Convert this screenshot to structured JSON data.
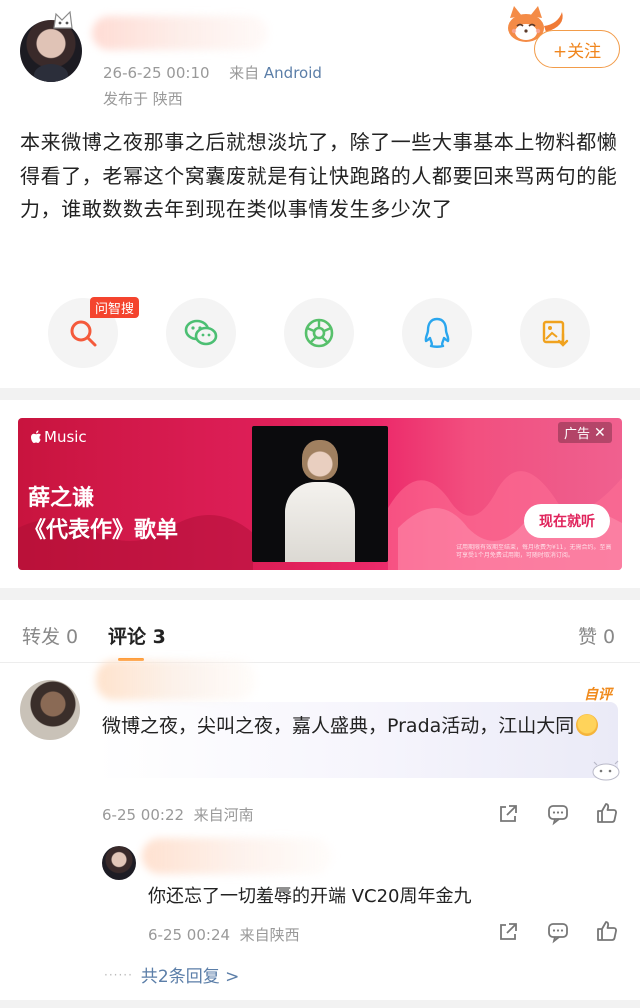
{
  "post": {
    "date": "26-6-25 00:10",
    "source_prefix": "来自",
    "source": "Android",
    "location": "发布于 陕西",
    "follow_label": "+关注",
    "text": "本来微博之夜那事之后就想淡坑了，除了一些大事基本上物料都懒得看了，老幂这个窝囊废就是有让快跑路的人都要回来骂两句的能力，谁敢数数去年到现在类似事情发生多少次了",
    "search_badge": "问智搜"
  },
  "banner": {
    "brand": "Music",
    "title_line1": "薛之谦",
    "title_line2": "《代表作》歌单",
    "ad_label": "广告",
    "cta": "现在就听",
    "fine_print": "试用期限有效期至结束，每月收费为¥11，无需合约。至高可享受1个月免费试用期，可随时取消订阅。"
  },
  "tabs": {
    "repost_label": "转发 0",
    "comment_label": "评论 3",
    "like_label": "赞 0"
  },
  "comment": {
    "self_badge": "自评",
    "text": "微博之夜，尖叫之夜，嘉人盛典，Prada活动，江山大同",
    "meta": "6-25 00:22  来自河南"
  },
  "reply": {
    "text": "你还忘了一切羞辱的开端 VC20周年金九",
    "meta": "6-25 00:24  来自陕西",
    "more_prefix": "······",
    "more": "共2条回复 >"
  },
  "colors": {
    "accent": "#ff8200",
    "link": "#5b7ea8",
    "wechat": "#4cbf73",
    "moments": "#57c06b",
    "qq": "#2aa6ee",
    "save": "#f0a21e",
    "search": "#f45a3b"
  }
}
